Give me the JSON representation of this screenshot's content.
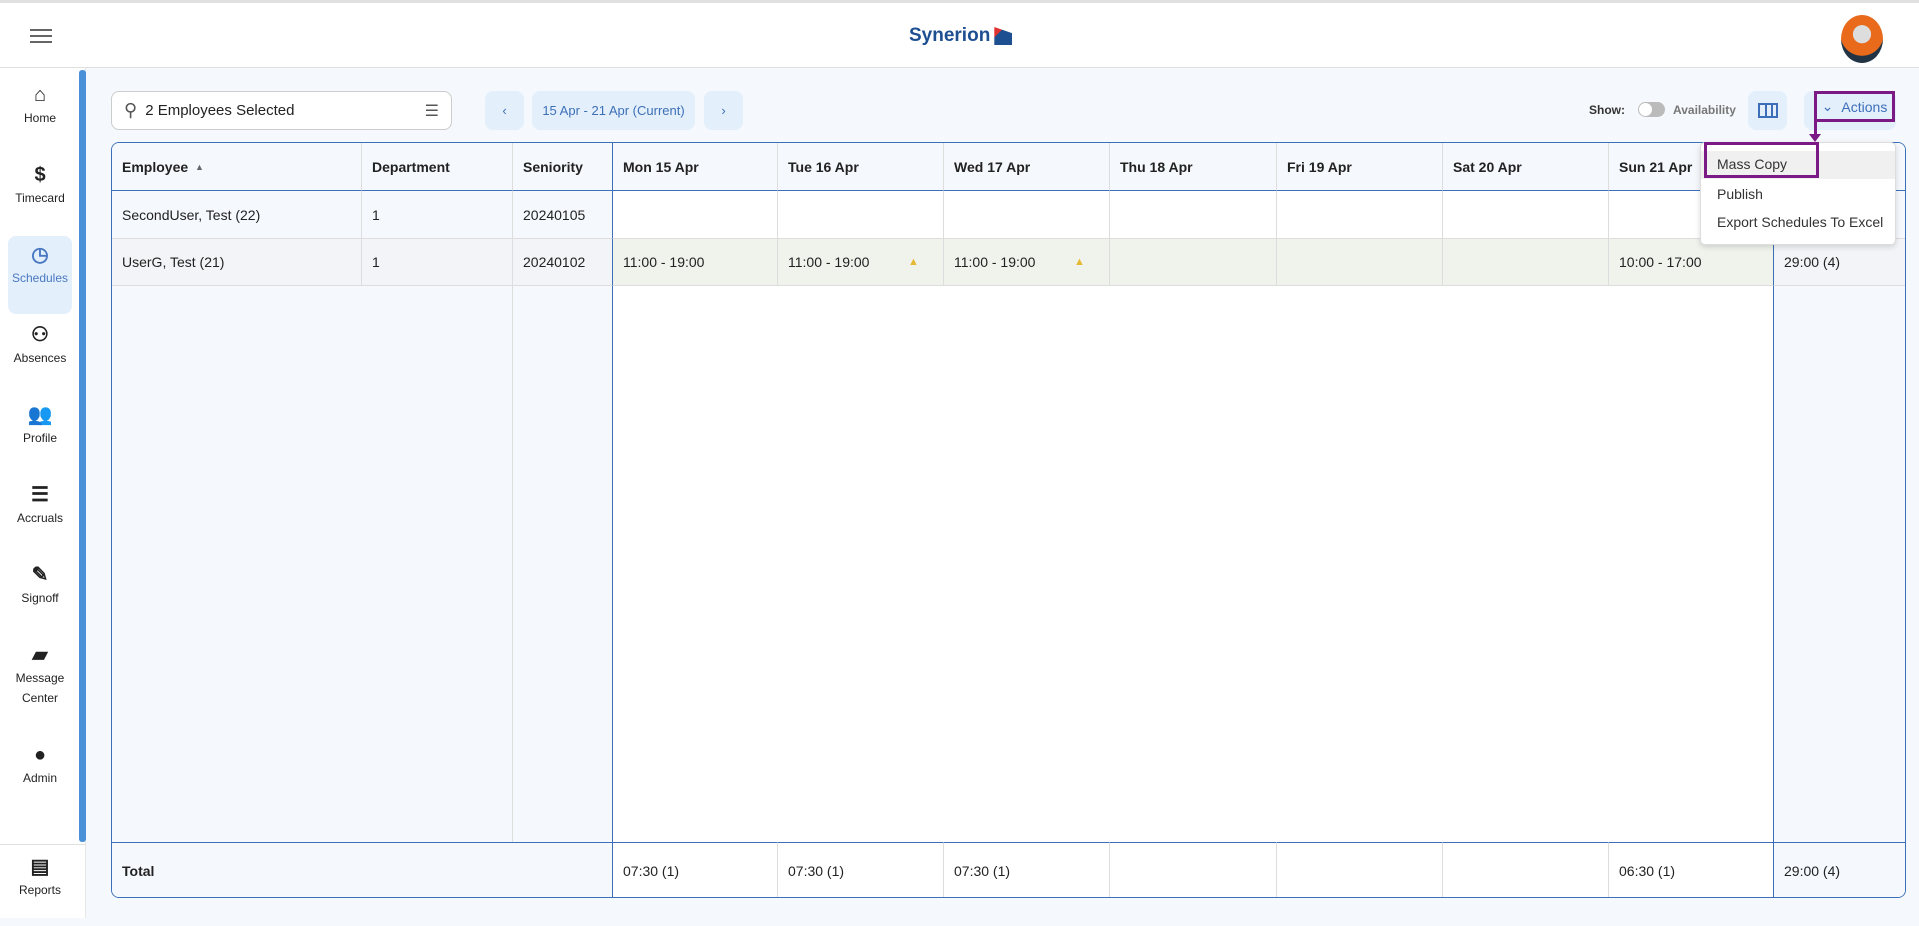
{
  "header": {
    "logo": "Synerion",
    "menu_icon": "hamburger-icon"
  },
  "sidebar": {
    "items": [
      {
        "label": "Home",
        "icon": "home-icon",
        "glyph": "⌂"
      },
      {
        "label": "Timecard",
        "icon": "dollar-icon",
        "glyph": "$"
      },
      {
        "label": "Schedules",
        "icon": "clock-icon",
        "glyph": "◷",
        "active": true
      },
      {
        "label": "Absences",
        "icon": "person-x-icon",
        "glyph": "⚇"
      },
      {
        "label": "Profile",
        "icon": "people-icon",
        "glyph": "👥"
      },
      {
        "label": "Accruals",
        "icon": "accruals-icon",
        "glyph": "☰"
      },
      {
        "label": "Signoff",
        "icon": "signoff-icon",
        "glyph": "✎"
      },
      {
        "label": "Message Center",
        "icon": "chat-icon",
        "glyph": "▰"
      },
      {
        "label": "Admin",
        "icon": "person-icon",
        "glyph": "●"
      },
      {
        "label": "Reports",
        "icon": "reports-icon",
        "glyph": "▤"
      }
    ]
  },
  "toolbar": {
    "search_value": "2 Employees Selected",
    "prev": "‹",
    "week": "15 Apr - 21 Apr (Current)",
    "next": "›",
    "show_label": "Show:",
    "availability_label": "Availability",
    "availability_on": false,
    "actions_label": "Actions"
  },
  "actions_menu": {
    "items": [
      "Mass Copy",
      "Publish",
      "Export Schedules To Excel"
    ],
    "highlighted": "Mass Copy"
  },
  "table": {
    "columns": [
      "Employee",
      "Department",
      "Seniority",
      "Mon 15 Apr",
      "Tue 16 Apr",
      "Wed 17 Apr",
      "Thu 18 Apr",
      "Fri 19 Apr",
      "Sat 20 Apr",
      "Sun 21 Apr",
      ""
    ],
    "sort": {
      "column": "Employee",
      "direction": "ascending"
    },
    "rows": [
      {
        "cells": [
          "SecondUser, Test (22)",
          "1",
          "20240105",
          "",
          "",
          "",
          "",
          "",
          "",
          "",
          ""
        ],
        "warnings": []
      },
      {
        "cells": [
          "UserG, Test (21)",
          "1",
          "20240102",
          "11:00 - 19:00",
          "11:00 - 19:00",
          "11:00 - 19:00",
          "",
          "",
          "",
          "10:00 - 17:00",
          "29:00 (4)"
        ],
        "warnings": [
          4,
          5
        ]
      }
    ],
    "footer": [
      "Total",
      "",
      "",
      "07:30 (1)",
      "07:30 (1)",
      "07:30 (1)",
      "",
      "",
      "",
      "06:30 (1)",
      "29:00 (4)"
    ]
  },
  "colors": {
    "accent": "#3d6fb8",
    "highlight": "#7b1a84",
    "warning": "#e6b933"
  }
}
